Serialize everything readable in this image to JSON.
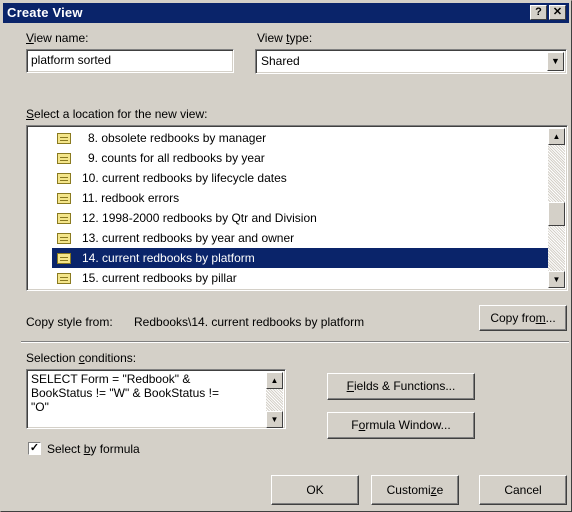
{
  "window": {
    "title": "Create View",
    "help_label": "?",
    "close_label": "✕"
  },
  "view_name": {
    "label_pre": "",
    "label_u": "V",
    "label_post": "iew name:",
    "value": "platform sorted"
  },
  "view_type": {
    "label_pre": "View ",
    "label_u": "t",
    "label_post": "ype:",
    "value": "Shared",
    "dropdown_icon": "▼"
  },
  "location": {
    "label_pre": "",
    "label_u": "S",
    "label_post": "elect a location for the new view:",
    "items": [
      {
        "label": "8. obsolete redbooks by manager",
        "selected": false
      },
      {
        "label": "9. counts for all redbooks by year",
        "selected": false
      },
      {
        "label": "10. current redbooks by lifecycle dates",
        "selected": false
      },
      {
        "label": "11. redbook errors",
        "selected": false
      },
      {
        "label": "12. 1998-2000 redbooks by Qtr and Division",
        "selected": false
      },
      {
        "label": "13. current redbooks by year and owner",
        "selected": false
      },
      {
        "label": "14. current redbooks by platform",
        "selected": true
      },
      {
        "label": "15. current redbooks by pillar",
        "selected": false
      }
    ],
    "scroll_up_icon": "▲",
    "scroll_down_icon": "▼"
  },
  "copy_style": {
    "label": "Copy style from:",
    "value": "Redbooks\\14. current redbooks by platform",
    "button_pre": "Copy fro",
    "button_u": "m",
    "button_post": "..."
  },
  "selection": {
    "label_pre": "Selection ",
    "label_u": "c",
    "label_post": "onditions:",
    "formula": "SELECT Form = \"Redbook\" &\nBookStatus != \"W\" & BookStatus !=\n\"O\"",
    "fields_button_pre": "",
    "fields_button_u": "F",
    "fields_button_post": "ields & Functions...",
    "formula_button_pre": "F",
    "formula_button_u": "o",
    "formula_button_post": "rmula Window...",
    "checkbox_mark": "✓",
    "checkbox_label_pre": "Select ",
    "checkbox_label_u": "b",
    "checkbox_label_post": "y formula",
    "checkbox_checked": true
  },
  "footer": {
    "ok_label": "OK",
    "customize_pre": "Customi",
    "customize_u": "z",
    "customize_post": "e",
    "cancel_label": "Cancel"
  },
  "colors": {
    "titlebar": "#0a246a",
    "face": "#d4d0c8",
    "selection": "#0a246a"
  }
}
